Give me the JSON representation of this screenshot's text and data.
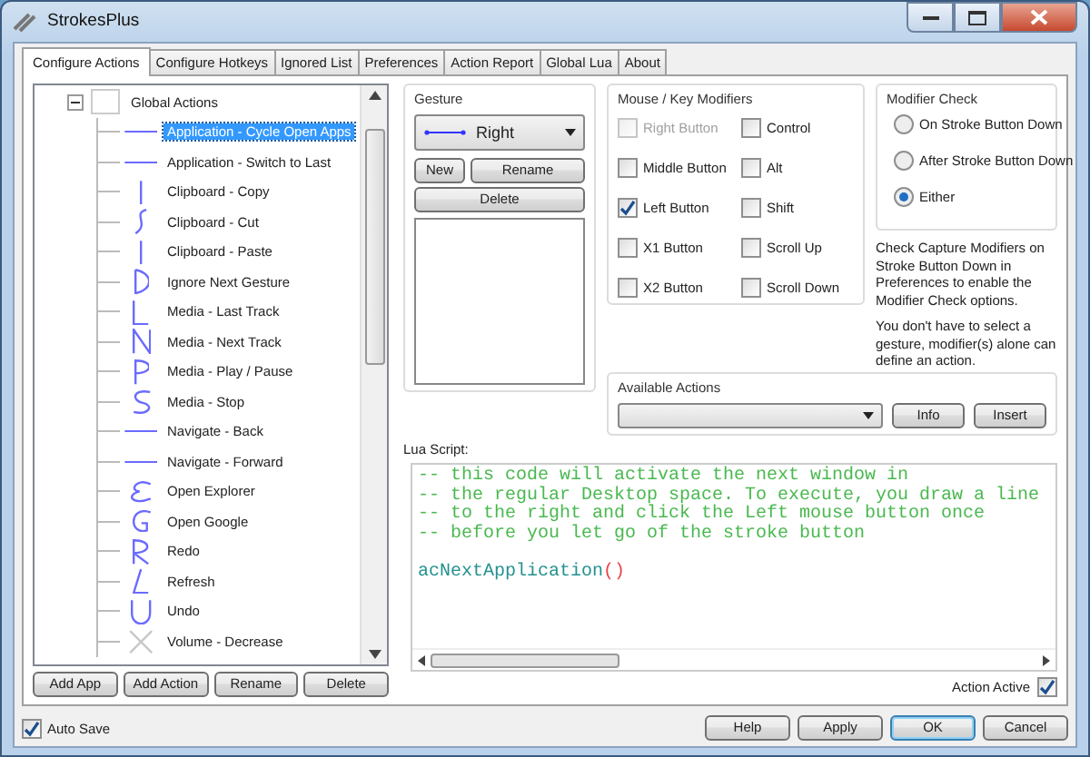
{
  "window": {
    "title": "StrokesPlus"
  },
  "tabs": [
    {
      "label": "Configure Actions",
      "selected": true
    },
    {
      "label": "Configure Hotkeys",
      "selected": false
    },
    {
      "label": "Ignored List",
      "selected": false
    },
    {
      "label": "Preferences",
      "selected": false
    },
    {
      "label": "Action Report",
      "selected": false
    },
    {
      "label": "Global Lua",
      "selected": false
    },
    {
      "label": "About",
      "selected": false
    }
  ],
  "tree": {
    "label": "Global Actions",
    "expanded": true,
    "children": [
      {
        "label": "Application - Cycle Open Apps",
        "selected": true
      },
      {
        "label": "Application - Switch to Last",
        "selected": false
      },
      {
        "label": "Clipboard - Copy",
        "selected": false
      },
      {
        "label": "Clipboard - Cut",
        "selected": false
      },
      {
        "label": "Clipboard - Paste",
        "selected": false
      },
      {
        "label": "Ignore Next Gesture",
        "selected": false
      },
      {
        "label": "Media - Last Track",
        "selected": false
      },
      {
        "label": "Media - Next Track",
        "selected": false
      },
      {
        "label": "Media - Play / Pause",
        "selected": false
      },
      {
        "label": "Media - Stop",
        "selected": false
      },
      {
        "label": "Navigate - Back",
        "selected": false
      },
      {
        "label": "Navigate - Forward",
        "selected": false
      },
      {
        "label": "Open Explorer",
        "selected": false
      },
      {
        "label": "Open Google",
        "selected": false
      },
      {
        "label": "Redo",
        "selected": false
      },
      {
        "label": "Refresh",
        "selected": false
      },
      {
        "label": "Undo",
        "selected": false
      },
      {
        "label": "Volume - Decrease",
        "selected": false
      }
    ]
  },
  "tree_buttons": [
    "Add App",
    "Add Action",
    "Rename",
    "Delete"
  ],
  "gesture": {
    "title": "Gesture",
    "value": "Right",
    "buttons": [
      "New",
      "Rename",
      "Delete"
    ]
  },
  "modifiers": {
    "title": "Mouse / Key Modifiers",
    "items": [
      {
        "label": "Right Button",
        "checked": false,
        "disabled": true
      },
      {
        "label": "Control",
        "checked": false,
        "disabled": false
      },
      {
        "label": "Middle Button",
        "checked": false,
        "disabled": false
      },
      {
        "label": "Alt",
        "checked": false,
        "disabled": false
      },
      {
        "label": "Left Button",
        "checked": true,
        "disabled": false
      },
      {
        "label": "Shift",
        "checked": false,
        "disabled": false
      },
      {
        "label": "X1 Button",
        "checked": false,
        "disabled": false
      },
      {
        "label": "Scroll Up",
        "checked": false,
        "disabled": false
      },
      {
        "label": "X2 Button",
        "checked": false,
        "disabled": false
      },
      {
        "label": "Scroll Down",
        "checked": false,
        "disabled": false
      }
    ]
  },
  "modifier_check": {
    "title": "Modifier Check",
    "options": [
      {
        "label": "On Stroke Button Down",
        "selected": false
      },
      {
        "label": "After Stroke Button Down",
        "selected": false
      },
      {
        "label": "Either",
        "selected": true
      }
    ],
    "notes": [
      "Check Capture Modifiers on Stroke Button Down in Preferences to enable the Modifier Check options.",
      "You don't have to select a gesture, modifier(s) alone can define an action."
    ]
  },
  "available_actions": {
    "title": "Available Actions",
    "buttons": [
      "Info",
      "Insert"
    ]
  },
  "lua_script": {
    "label": "Lua Script:",
    "lines": [
      {
        "kind": "comment",
        "segments": [
          {
            "kind": "comment",
            "text": "-- this code will activate the next window in"
          }
        ]
      },
      {
        "kind": "comment",
        "segments": [
          {
            "kind": "comment",
            "text": "-- the regular Desktop space. To execute, you draw a line"
          }
        ]
      },
      {
        "kind": "comment",
        "segments": [
          {
            "kind": "comment",
            "text": "-- to the right and click the Left mouse button once"
          }
        ]
      },
      {
        "kind": "comment",
        "segments": [
          {
            "kind": "comment",
            "text": "-- before you let go of the stroke button"
          }
        ]
      },
      {
        "kind": "blank"
      },
      {
        "kind": "code",
        "segments": [
          {
            "kind": "function",
            "text": "acNextApplication"
          },
          {
            "kind": "paren",
            "text": "()"
          }
        ]
      }
    ]
  },
  "action_active": {
    "label": "Action Active",
    "checked": true
  },
  "auto_save": {
    "label": "Auto Save",
    "checked": true
  },
  "dialog_buttons": [
    {
      "label": "Help",
      "default": false
    },
    {
      "label": "Apply",
      "default": false
    },
    {
      "label": "OK",
      "default": true
    },
    {
      "label": "Cancel",
      "default": false
    }
  ]
}
